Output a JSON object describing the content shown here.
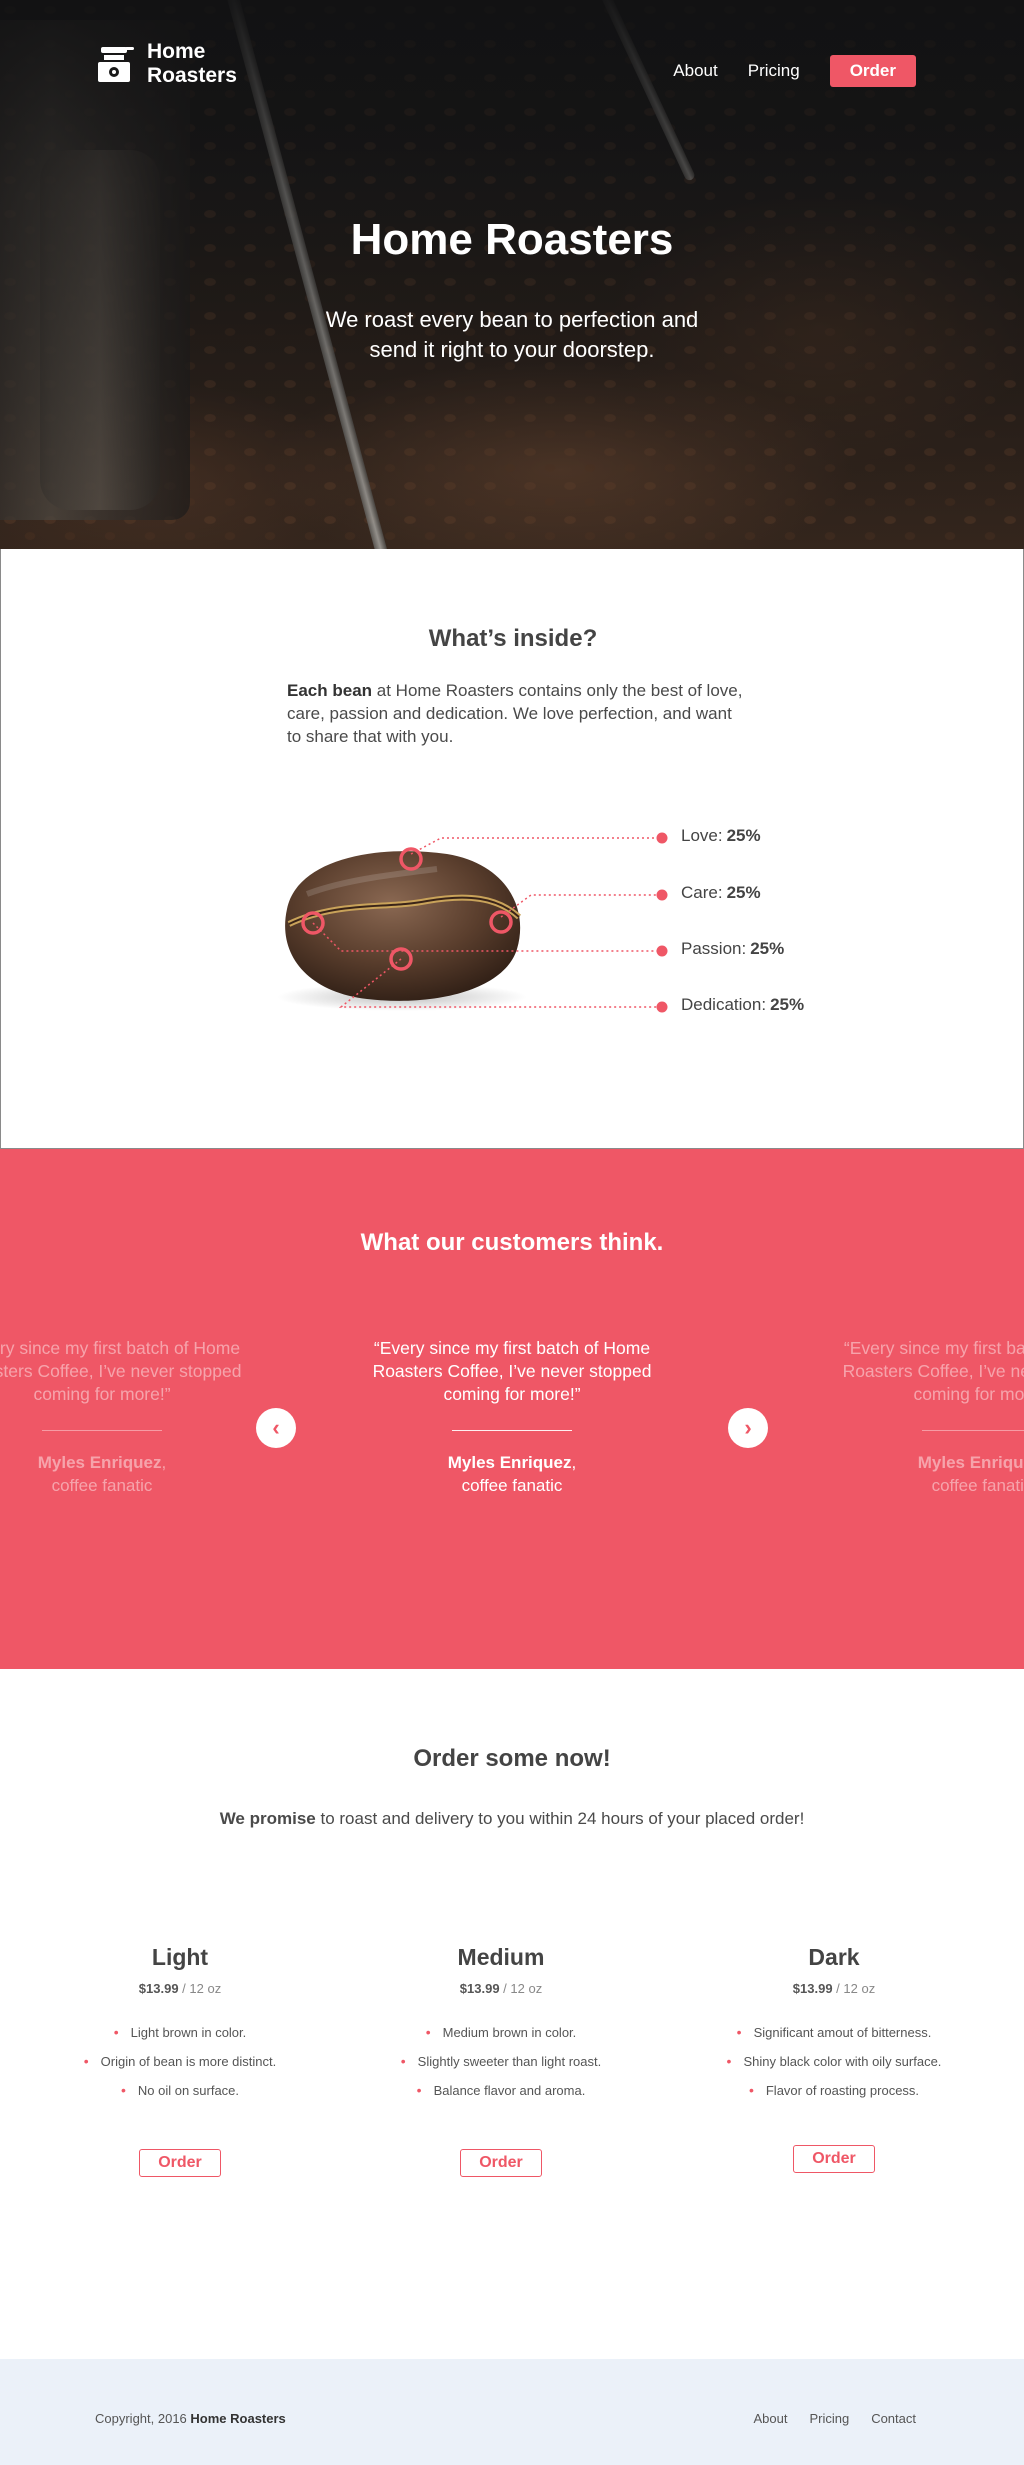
{
  "brand": {
    "name_line1": "Home",
    "name_line2": "Roasters"
  },
  "nav": {
    "about": "About",
    "pricing": "Pricing",
    "order": "Order"
  },
  "hero": {
    "title": "Home Roasters",
    "subtitle": "We roast every bean to perfection and send it right to your doorstep."
  },
  "inside": {
    "title": "What’s inside?",
    "lead_bold": "Each bean",
    "lead_rest": " at Home Roasters contains only the best of love, care, passion and dedication. We love perfection, and want to share that with you.",
    "ingredients": [
      {
        "label": "Love:",
        "value": "25%"
      },
      {
        "label": "Care:",
        "value": "25%"
      },
      {
        "label": "Passion:",
        "value": "25%"
      },
      {
        "label": "Dedication:",
        "value": "25%"
      }
    ]
  },
  "testimonials": {
    "title": "What our customers think.",
    "quote": "“Every since my first batch of Home Roasters Coffee, I’ve never stopped coming for more!”",
    "author_name": "Myles Enriquez",
    "author_comma": ",",
    "author_role": "coffee fanatic",
    "prev_arrow": "‹",
    "next_arrow": "›"
  },
  "order": {
    "title": "Order some now!",
    "promise_bold": "We promise",
    "promise_rest": " to roast and delivery to you within 24 hours of your placed order!",
    "plans": [
      {
        "name": "Light",
        "price": "$13.99",
        "unit": " / 12 oz",
        "features": [
          "Light brown in color.",
          "Origin of bean is more distinct.",
          "No oil on surface."
        ],
        "button": "Order"
      },
      {
        "name": "Medium",
        "price": "$13.99",
        "unit": " / 12 oz",
        "features": [
          "Medium brown in color.",
          "Slightly sweeter than light roast.",
          "Balance flavor and aroma."
        ],
        "button": "Order"
      },
      {
        "name": "Dark",
        "price": "$13.99",
        "unit": " / 12 oz",
        "features": [
          "Significant amout of bitterness.",
          "Shiny black color with oily surface.",
          "Flavor of roasting process."
        ],
        "button": "Order"
      }
    ]
  },
  "footer": {
    "copy_prefix": "Copyright, 2016 ",
    "copy_brand": "Home Roasters",
    "links": [
      "About",
      "Pricing",
      "Contact"
    ]
  },
  "colors": {
    "accent": "#ef5766",
    "footer_bg": "#ebf1f9",
    "text": "#3d3d3d"
  }
}
